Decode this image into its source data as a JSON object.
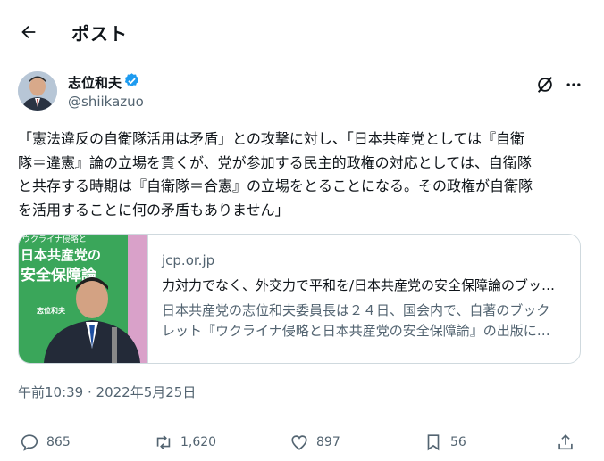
{
  "header": {
    "title": "ポスト"
  },
  "author": {
    "display_name": "志位和夫",
    "handle": "@shiikazuo"
  },
  "tweet": {
    "text": "「憲法違反の自衛隊活用は矛盾」との攻撃に対し、「日本共産党としては『自衛\n隊＝違憲』論の立場を貫くが、党が参加する民主的政権の対応としては、自衛隊\nと共存する時期は『自衛隊＝合憲』の立場をとることになる。その政権が自衛隊\nを活用することに何の矛盾もありません」"
  },
  "card": {
    "domain": "jcp.or.jp",
    "title": "力対力でなく、外交力で平和を/日本共産党の安全保障論のブッ…",
    "description": "日本共産党の志位和夫委員長は２４日、国会内で、自著のブック\nレット『ウクライナ侵略と日本共産党の安全保障論』の出版に…",
    "cover_top": "ウクライナ侵略と",
    "cover_line1": "日本共産党の",
    "cover_line2": "安全保障論",
    "cover_author": "志位和夫"
  },
  "timestamp": "午前10:39 · 2022年5月25日",
  "actions": {
    "replies": "865",
    "reposts": "1,620",
    "likes": "897",
    "bookmarks": "56"
  },
  "colors": {
    "text": "#0f1419",
    "secondary": "#536471",
    "border": "#cfd9de",
    "verified": "#1d9bf0"
  },
  "icons": [
    "back-arrow-icon",
    "verified-badge-icon",
    "grok-icon",
    "more-icon",
    "reply-icon",
    "repost-icon",
    "like-icon",
    "bookmark-icon",
    "share-icon"
  ]
}
